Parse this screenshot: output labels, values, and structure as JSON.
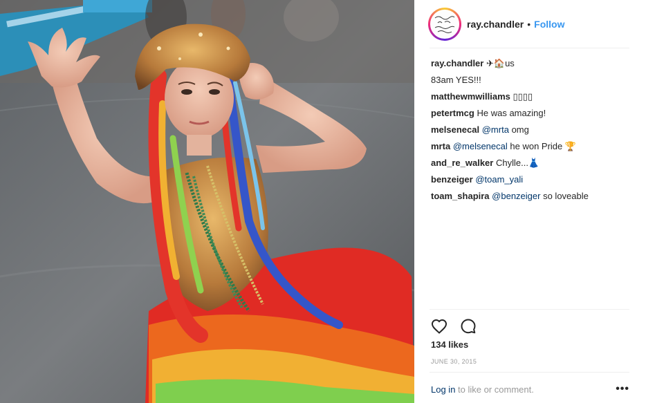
{
  "post": {
    "author": "ray.chandler",
    "separator": "•",
    "follow_label": "Follow",
    "avatar_icon": "handwritten-text-avatar"
  },
  "comments": [
    {
      "user": "ray.chandler",
      "text": "✈🏠us",
      "mention": ""
    },
    {
      "user": "",
      "text": "83am YES!!!",
      "mention": ""
    },
    {
      "user": "matthewmwilliams",
      "text": "▯▯▯▯",
      "mention": ""
    },
    {
      "user": "petertmcg",
      "text": "He was amazing!",
      "mention": ""
    },
    {
      "user": "melsenecal",
      "mention": "@mrta",
      "text": "omg"
    },
    {
      "user": "mrta",
      "mention": "@melsenecal",
      "text": "he won Pride 🏆"
    },
    {
      "user": "and_re_walker",
      "text": "Chylle...👗",
      "mention": ""
    },
    {
      "user": "benzeiger",
      "mention": "@toam_yali",
      "text": ""
    },
    {
      "user": "toam_shapira",
      "mention": "@benzeiger",
      "text": "so loveable"
    }
  ],
  "actions": {
    "like_icon": "heart-icon",
    "comment_icon": "comment-icon"
  },
  "likes": "134 likes",
  "date": "JUNE 30, 2015",
  "login": {
    "link": "Log in",
    "text": " to like or comment."
  },
  "more_label": "•••",
  "colors": {
    "accent": "#3897f0",
    "mention": "#003569",
    "muted": "#999999",
    "text": "#262626"
  }
}
